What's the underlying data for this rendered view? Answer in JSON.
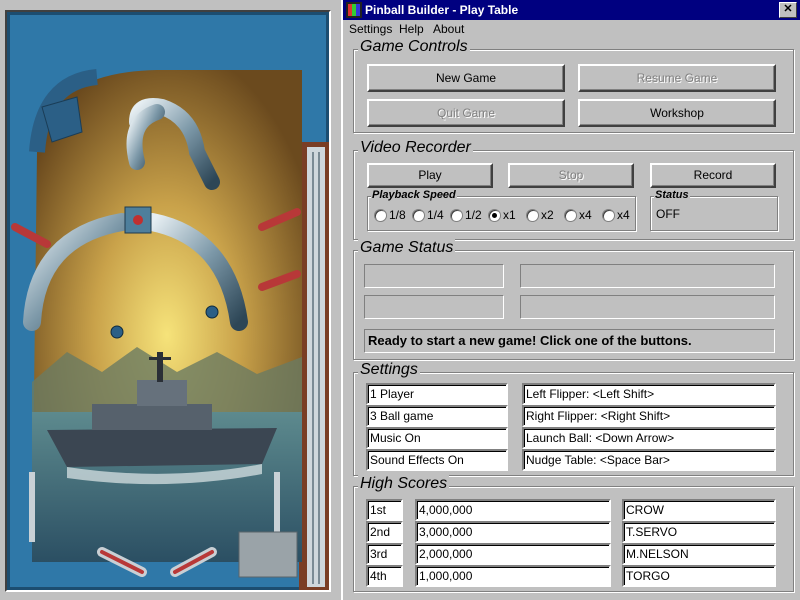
{
  "window": {
    "title": "Pinball Builder - Play Table",
    "close_label": "✕"
  },
  "menu": [
    "Settings",
    "Help",
    "About"
  ],
  "game_controls": {
    "title": "Game Controls",
    "new_game": "New Game",
    "resume_game": "Resume Game",
    "quit_game": "Quit Game",
    "workshop": "Workshop"
  },
  "video_recorder": {
    "title": "Video Recorder",
    "play": "Play",
    "stop": "Stop",
    "record": "Record",
    "playback_title": "Playback Speed",
    "speeds": [
      "1/8",
      "1/4",
      "1/2",
      "x1",
      "x2",
      "x4",
      "x4"
    ],
    "selected_speed_index": 3,
    "status_title": "Status",
    "status_value": "OFF"
  },
  "game_status": {
    "title": "Game Status",
    "message": "Ready to start a new game! Click one of the buttons."
  },
  "settings": {
    "title": "Settings",
    "left": [
      "1 Player",
      "3 Ball game",
      "Music On",
      "Sound Effects On"
    ],
    "right": [
      "Left Flipper:  <Left Shift>",
      "Right Flipper:  <Right Shift>",
      "Launch Ball:  <Down Arrow>",
      "Nudge Table:  <Space Bar>"
    ]
  },
  "high_scores": {
    "title": "High Scores",
    "rows": [
      {
        "rank": "1st",
        "score": "4,000,000",
        "name": "CROW"
      },
      {
        "rank": "2nd",
        "score": "3,000,000",
        "name": "T.SERVO"
      },
      {
        "rank": "3rd",
        "score": "2,000,000",
        "name": "M.NELSON"
      },
      {
        "rank": "4th",
        "score": "1,000,000",
        "name": "TORGO"
      }
    ]
  }
}
